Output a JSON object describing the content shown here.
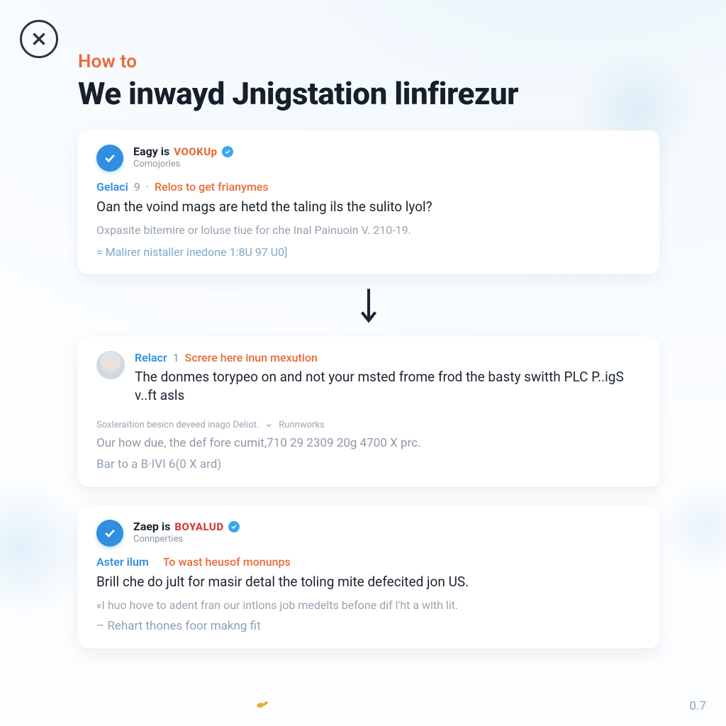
{
  "kicker": "How to",
  "headline": "We inwayd Jnigstation linfirezur",
  "version": "0.7",
  "cards": [
    {
      "name": "Eagy is",
      "brand": "VOOKUp",
      "brand_color": "brand-orange",
      "subtitle": "Comojorles",
      "meta_blue": "Gelaci",
      "meta_num": "9",
      "meta_orange": "Relos to get frianymes",
      "main": "Oan the voind mags are hetd the taling ils the sulito lyol?",
      "muted": "Oxpasite bitemire or loluse tiue for che Inal Painuoin V. 210-19.",
      "foot": "= Malirer nistaller inedone 1:8U 97 U0]"
    },
    {
      "meta_blue": "Relacr",
      "meta_num": "1",
      "meta_orange": "Screre here inun mexution",
      "main": "The donmes torypeo on and not your msted frome frod the basty switth PLC P..igS v..ft asls",
      "tinytag_a": "Soxleraition besicn deveed inago Deliot.",
      "tinytag_b": "Runnworks",
      "muted_mid": "Our how due, the def fore cumit,710 29 2309 20g 4700 X prc.",
      "foot": "Bar to a B·IVI 6(0 X ard)"
    },
    {
      "name": "Zaep is",
      "brand": "BOYALUD",
      "brand_color": "brand-red",
      "subtitle": "Connperties",
      "meta_blue": "Aster ilum",
      "meta_num": " ",
      "meta_orange": "To wast heusof monunps",
      "main": "Brill che do jult for masir detal the toling mite defecited jon US.",
      "muted": "«I huo hove to adent fran our intlons job medelts befone dif l'ht a with lit.",
      "foot": "– Rehart thones foor makng fit"
    }
  ],
  "icons": {
    "bird": "❰"
  }
}
